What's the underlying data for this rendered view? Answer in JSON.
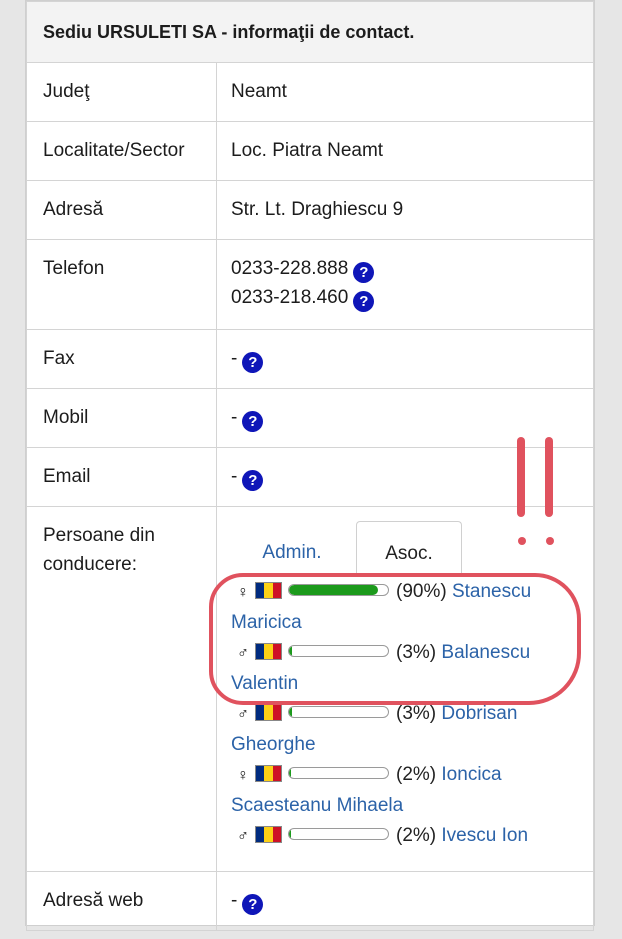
{
  "header": {
    "title": "Sediu URSULETI SA - informaţii de contact."
  },
  "rows": [
    {
      "label": "Judeţ",
      "value": "Neamt"
    },
    {
      "label": "Localitate/Sector",
      "value": "Loc. Piatra Neamt"
    },
    {
      "label": "Adresă",
      "value": "Str. Lt. Draghiescu 9"
    }
  ],
  "telefon": {
    "label": "Telefon",
    "numbers": [
      "0233-228.888",
      "0233-218.460"
    ]
  },
  "fax": {
    "label": "Fax",
    "value": "-"
  },
  "mobil": {
    "label": "Mobil",
    "value": "-"
  },
  "email": {
    "label": "Email",
    "value": "-"
  },
  "persoane": {
    "label": "Persoane din conducere:",
    "tabs": {
      "admin": "Admin.",
      "asoc": "Asoc.",
      "active": "Asoc."
    },
    "people": [
      {
        "icon": "female-person-icon",
        "pct": "(90%)",
        "share": 0.9,
        "name": "Stanescu Maricica"
      },
      {
        "icon": "male-person-icon",
        "pct": "(3%)",
        "share": 0.03,
        "name": "Balanescu Valentin"
      },
      {
        "icon": "male-person-icon",
        "pct": "(3%)",
        "share": 0.03,
        "name": "Dobrisan Gheorghe"
      },
      {
        "icon": "female-person-icon",
        "pct": "(2%)",
        "share": 0.02,
        "name": "Ioncica Scaesteanu Mihaela"
      },
      {
        "icon": "male-person-icon",
        "pct": "(2%)",
        "share": 0.02,
        "name": "Ivescu Ion"
      }
    ]
  },
  "web": {
    "label": "Adresă web",
    "value": "-"
  },
  "colors": {
    "link": "#2c63a8",
    "help_icon": "#0f16b8",
    "bar_fill": "#1c9a1c",
    "annotation": "#e0525e",
    "flag": [
      "#002b7f",
      "#fcd116",
      "#ce1126"
    ]
  }
}
